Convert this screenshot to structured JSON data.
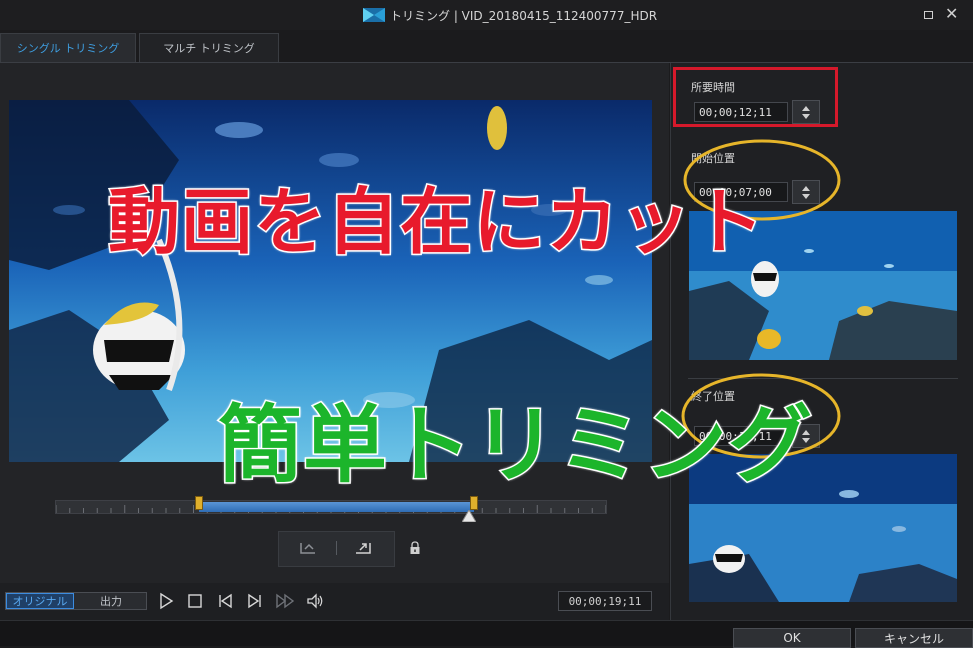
{
  "window": {
    "title": "トリミング | VID_20180415_112400777_HDR",
    "app_icon": "film-logo-icon",
    "maximize_icon": "maximize-icon",
    "close_label": "✕"
  },
  "tabs": [
    {
      "label": "シングル トリミング",
      "active": true
    },
    {
      "label": "マルチ トリミング",
      "active": false
    }
  ],
  "overlay": {
    "caption_top": "動画を自在にカット",
    "caption_bottom": "簡単トリミング"
  },
  "timeline": {
    "selection_start_fraction": 0.26,
    "selection_end_fraction": 0.76,
    "playhead_fraction": 0.75
  },
  "toolbar": {
    "mode_original": "オリジナル",
    "mode_output": "出力",
    "current_timecode": "00;00;19;11",
    "icons": [
      "play-icon",
      "stop-icon",
      "previous-frame-icon",
      "next-frame-icon",
      "fast-forward-icon",
      "volume-icon",
      "mark-in-icon",
      "mark-out-icon",
      "lock-icon"
    ]
  },
  "right_panel": {
    "duration": {
      "label": "所要時間",
      "value": "00;00;12;11"
    },
    "start": {
      "label": "開始位置",
      "value": "00;00;07;00"
    },
    "end": {
      "label": "終了位置",
      "value": "00;00;19;11"
    }
  },
  "footer": {
    "ok_label": "OK",
    "cancel_label": "キャンセル"
  },
  "colors": {
    "accent_blue": "#3e9ee0",
    "highlight_red": "#d5192b",
    "ellipse_gold": "#e6b52a",
    "caption_red": "#e81a2c",
    "caption_green": "#1cb52b"
  }
}
